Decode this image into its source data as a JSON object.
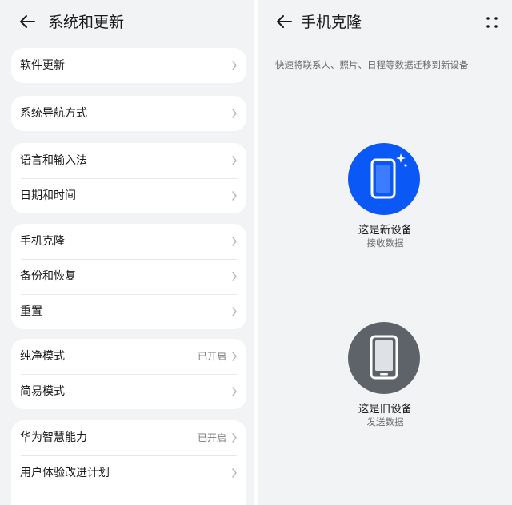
{
  "left": {
    "title": "系统和更新",
    "back_icon": "arrow-left-icon",
    "groups": [
      {
        "items": [
          {
            "label": "软件更新",
            "value": ""
          }
        ]
      },
      {
        "items": [
          {
            "label": "系统导航方式",
            "value": ""
          }
        ]
      },
      {
        "items": [
          {
            "label": "语言和输入法",
            "value": ""
          },
          {
            "label": "日期和时间",
            "value": ""
          }
        ]
      },
      {
        "items": [
          {
            "label": "手机克隆",
            "value": ""
          },
          {
            "label": "备份和恢复",
            "value": ""
          },
          {
            "label": "重置",
            "value": ""
          }
        ]
      },
      {
        "items": [
          {
            "label": "纯净模式",
            "value": "已开启"
          },
          {
            "label": "简易模式",
            "value": ""
          }
        ]
      },
      {
        "items": [
          {
            "label": "华为智慧能力",
            "value": "已开启"
          },
          {
            "label": "用户体验改进计划",
            "value": ""
          }
        ]
      }
    ]
  },
  "right": {
    "title": "手机克隆",
    "back_icon": "arrow-left-icon",
    "menu_icon": "more-dots-icon",
    "subtitle": "快速将联系人、照片、日程等数据迁移到新设备",
    "options": [
      {
        "title": "这是新设备",
        "subtitle": "接收数据",
        "icon": "new-phone-icon",
        "color": "#0a59f7"
      },
      {
        "title": "这是旧设备",
        "subtitle": "发送数据",
        "icon": "old-phone-icon",
        "color": "#5d6368"
      }
    ]
  },
  "colors": {
    "background": "#f1f3f5",
    "card": "#ffffff",
    "accent": "#0a59f7",
    "secondary_text": "#7a7a7a"
  }
}
